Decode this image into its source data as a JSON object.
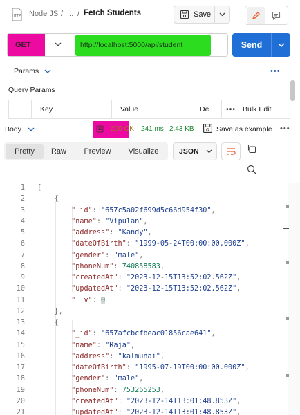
{
  "header": {
    "http_icon": "http-file-icon",
    "crumb_root": "Node JS",
    "crumb_sep1": "/",
    "crumb_mid": "...",
    "crumb_sep2": "/",
    "title": "Fetch Students",
    "save_label": "Save"
  },
  "request": {
    "method": "GET",
    "url": "http://localhost:5000/api/student",
    "send_label": "Send"
  },
  "params": {
    "tab_label": "Params",
    "query_params_label": "Query Params",
    "columns": [
      "Key",
      "Value",
      "De...",
      "Bulk Edit"
    ]
  },
  "response": {
    "body_tab": "Body",
    "status": "200 OK",
    "time": "241 ms",
    "size": "2.43 KB",
    "save_example": "Save as example",
    "view_tabs": [
      "Pretty",
      "Raw",
      "Preview",
      "Visualize"
    ],
    "active_view": "Pretty",
    "format": "JSON"
  },
  "code_lines": [
    {
      "n": "1",
      "html": "<span class=\"p\">[</span>"
    },
    {
      "n": "2",
      "html": "    <span class=\"p\">{</span>"
    },
    {
      "n": "3",
      "html": "        <span class=\"k\">\"_id\"</span><span class=\"p\">: </span><span class=\"s\">\"657c5a02f699d5c66d954f30\"</span><span class=\"p\">,</span>"
    },
    {
      "n": "4",
      "html": "        <span class=\"k\">\"name\"</span><span class=\"p\">: </span><span class=\"s\">\"Vipulan\"</span><span class=\"p\">,</span>"
    },
    {
      "n": "5",
      "html": "        <span class=\"k\">\"address\"</span><span class=\"p\">: </span><span class=\"s\">\"Kandy\"</span><span class=\"p\">,</span>"
    },
    {
      "n": "6",
      "html": "        <span class=\"k\">\"dateOfBirth\"</span><span class=\"p\">: </span><span class=\"s\">\"1999-05-24T00:00:00.000Z\"</span><span class=\"p\">,</span>"
    },
    {
      "n": "7",
      "html": "        <span class=\"k\">\"gender\"</span><span class=\"p\">: </span><span class=\"s\">\"male\"</span><span class=\"p\">,</span>"
    },
    {
      "n": "8",
      "html": "        <span class=\"k\">\"phoneNum\"</span><span class=\"p\">: </span><span class=\"n\">740858583</span><span class=\"p\">,</span>"
    },
    {
      "n": "9",
      "html": "        <span class=\"k\">\"createdAt\"</span><span class=\"p\">: </span><span class=\"s\">\"2023-12-15T13:52:02.562Z\"</span><span class=\"p\">,</span>"
    },
    {
      "n": "10",
      "html": "        <span class=\"k\">\"updatedAt\"</span><span class=\"p\">: </span><span class=\"s\">\"2023-12-15T13:52:02.562Z\"</span><span class=\"p\">,</span>"
    },
    {
      "n": "11",
      "html": "        <span class=\"k\">\"__v\"</span><span class=\"p\">: </span><span class=\"n zero-hl\">0</span>"
    },
    {
      "n": "12",
      "html": "    <span class=\"p\">},</span>"
    },
    {
      "n": "13",
      "html": "    <span class=\"p\">{</span>"
    },
    {
      "n": "14",
      "html": "        <span class=\"k\">\"_id\"</span><span class=\"p\">: </span><span class=\"s\">\"657afcbcfbeac01856cae641\"</span><span class=\"p\">,</span>"
    },
    {
      "n": "15",
      "html": "        <span class=\"k\">\"name\"</span><span class=\"p\">: </span><span class=\"s\">\"Raja\"</span><span class=\"p\">,</span>"
    },
    {
      "n": "16",
      "html": "        <span class=\"k\">\"address\"</span><span class=\"p\">: </span><span class=\"s\">\"kalmunai\"</span><span class=\"p\">,</span>"
    },
    {
      "n": "17",
      "html": "        <span class=\"k\">\"dateOfBirth\"</span><span class=\"p\">: </span><span class=\"s\">\"1995-07-19T00:00:00.000Z\"</span><span class=\"p\">,</span>"
    },
    {
      "n": "18",
      "html": "        <span class=\"k\">\"gender\"</span><span class=\"p\">: </span><span class=\"s\">\"male\"</span><span class=\"p\">,</span>"
    },
    {
      "n": "19",
      "html": "        <span class=\"k\">\"phoneNum\"</span><span class=\"p\">: </span><span class=\"n\">753265253</span><span class=\"p\">,</span>"
    },
    {
      "n": "20",
      "html": "        <span class=\"k\">\"createdAt\"</span><span class=\"p\">: </span><span class=\"s\">\"2023-12-14T13:01:48.853Z\"</span><span class=\"p\">,</span>"
    },
    {
      "n": "21",
      "html": "        <span class=\"k\">\"updatedAt\"</span><span class=\"p\">: </span><span class=\"s\">\"2023-12-14T13:01:48.853Z\"</span><span class=\"p\">,</span>"
    }
  ],
  "colors": {
    "highlight_pink": "#ec0aa0",
    "highlight_green": "#2bdc1f",
    "send_blue": "#1f6fd6"
  }
}
